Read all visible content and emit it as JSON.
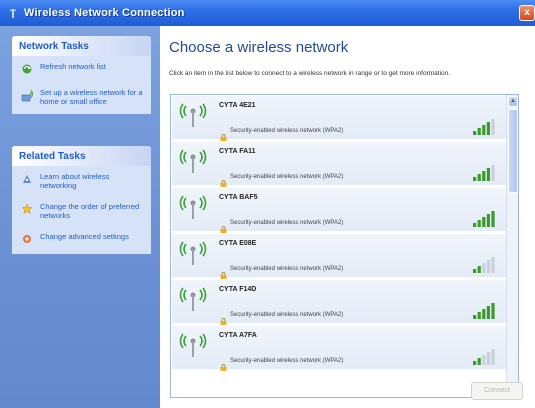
{
  "window": {
    "title": "Wireless Network Connection",
    "close_glyph": "x"
  },
  "sidebar": {
    "network_tasks": {
      "title": "Network Tasks",
      "items": [
        {
          "label": "Refresh network list",
          "icon": "refresh-icon"
        },
        {
          "label": "Set up a wireless network for a home or small office",
          "icon": "setup-network-icon"
        }
      ]
    },
    "related_tasks": {
      "title": "Related Tasks",
      "items": [
        {
          "label": "Learn about wireless networking",
          "icon": "info-icon"
        },
        {
          "label": "Change the order of preferred networks",
          "icon": "star-icon"
        },
        {
          "label": "Change advanced settings",
          "icon": "settings-icon"
        }
      ]
    }
  },
  "main": {
    "heading": "Choose a wireless network",
    "instructions": "Click an item in the list below to connect to a wireless network in range or to get more information.",
    "networks": [
      {
        "ssid": "CYTA 4E21",
        "security": "Security-enabled wireless network (WPA2)",
        "signal_bars": 4
      },
      {
        "ssid": "CYTA FA11",
        "security": "Security-enabled wireless network (WPA2)",
        "signal_bars": 4
      },
      {
        "ssid": "CYTA BAF5",
        "security": "Security-enabled wireless network (WPA2)",
        "signal_bars": 5
      },
      {
        "ssid": "CYTA E08E",
        "security": "Security-enabled wireless network (WPA2)",
        "signal_bars": 2
      },
      {
        "ssid": "CYTA F14D",
        "security": "Security-enabled wireless network (WPA2)",
        "signal_bars": 5
      },
      {
        "ssid": "CYTA A7FA",
        "security": "Security-enabled wireless network (WPA2)",
        "signal_bars": 2
      }
    ],
    "connect_label": "Connect"
  },
  "colors": {
    "titlebar": "#2d6ee6",
    "sidebar_bg": "#6d92d5",
    "task_link": "#215dc6",
    "heading": "#244a9a",
    "signal_on": "#3a9a2a",
    "signal_off": "#c8d0dc"
  }
}
